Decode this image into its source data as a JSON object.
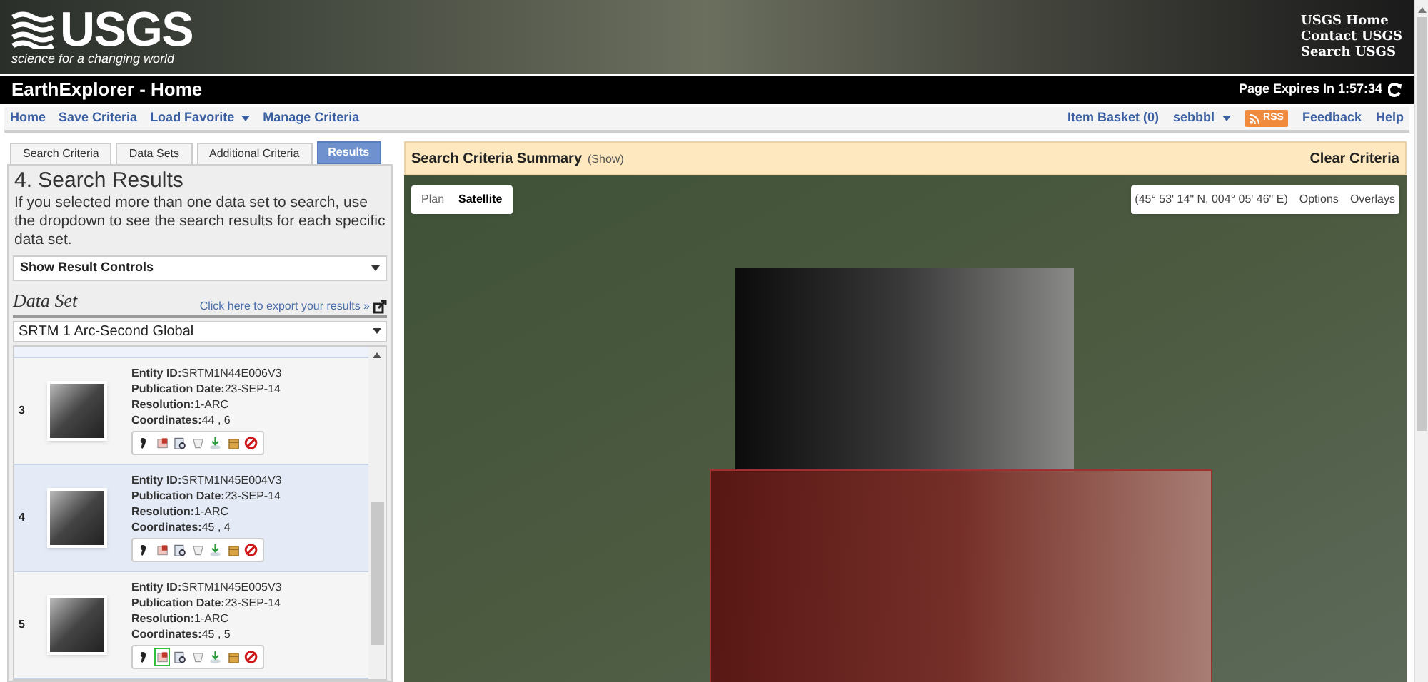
{
  "header": {
    "logo": "USGS",
    "tagline": "science for a changing world",
    "links": [
      "USGS Home",
      "Contact USGS",
      "Search USGS"
    ]
  },
  "title_bar": {
    "title": "EarthExplorer - Home",
    "expires": "Page Expires In 1:57:34"
  },
  "nav": {
    "left": [
      {
        "label": "Home",
        "dropdown": false
      },
      {
        "label": "Save Criteria",
        "dropdown": false
      },
      {
        "label": "Load Favorite",
        "dropdown": true
      },
      {
        "label": "Manage Criteria",
        "dropdown": false
      }
    ],
    "right": [
      {
        "kind": "link",
        "label": "Item Basket (0)"
      },
      {
        "kind": "menu",
        "label": "sebbbl"
      },
      {
        "kind": "rss",
        "label": "RSS"
      },
      {
        "kind": "link",
        "label": "Feedback"
      },
      {
        "kind": "link",
        "label": "Help"
      }
    ]
  },
  "tabs": [
    {
      "label": "Search Criteria",
      "selected": false
    },
    {
      "label": "Data Sets",
      "selected": false
    },
    {
      "label": "Additional Criteria",
      "selected": false
    },
    {
      "label": "Results",
      "selected": true
    }
  ],
  "panel": {
    "heading": "4. Search Results",
    "description": "If you selected more than one data set to search, use the dropdown to see the search results for each specific data set.",
    "result_controls": "Show Result Controls",
    "dataset_label": "Data Set",
    "export_link": "Click here to export your results »",
    "dataset": "SRTM 1 Arc-Second Global"
  },
  "results": [
    {
      "number": "3",
      "selected": false,
      "overlay_on": false,
      "fields": [
        {
          "label": "Entity ID:",
          "value": "SRTM1N44E006V3"
        },
        {
          "label": "Publication Date:",
          "value": "23-SEP-14"
        },
        {
          "label": "Resolution:",
          "value": "1-ARC"
        },
        {
          "label": "Coordinates:",
          "value": "44 , 6"
        }
      ]
    },
    {
      "number": "4",
      "selected": true,
      "overlay_on": false,
      "fields": [
        {
          "label": "Entity ID:",
          "value": "SRTM1N45E004V3"
        },
        {
          "label": "Publication Date:",
          "value": "23-SEP-14"
        },
        {
          "label": "Resolution:",
          "value": "1-ARC"
        },
        {
          "label": "Coordinates:",
          "value": "45 , 4"
        }
      ]
    },
    {
      "number": "5",
      "selected": false,
      "overlay_on": true,
      "fields": [
        {
          "label": "Entity ID:",
          "value": "SRTM1N45E005V3"
        },
        {
          "label": "Publication Date:",
          "value": "23-SEP-14"
        },
        {
          "label": "Resolution:",
          "value": "1-ARC"
        },
        {
          "label": "Coordinates:",
          "value": "45 , 5"
        }
      ]
    }
  ],
  "summary": {
    "title": "Search Criteria Summary",
    "show": "(Show)",
    "clear": "Clear Criteria"
  },
  "map": {
    "map_types": [
      {
        "label": "Plan",
        "selected": false
      },
      {
        "label": "Satellite",
        "selected": true
      }
    ],
    "coordinates": "(45° 53' 14\" N, 004° 05' 46\" E)",
    "buttons": [
      "Options",
      "Overlays"
    ]
  }
}
